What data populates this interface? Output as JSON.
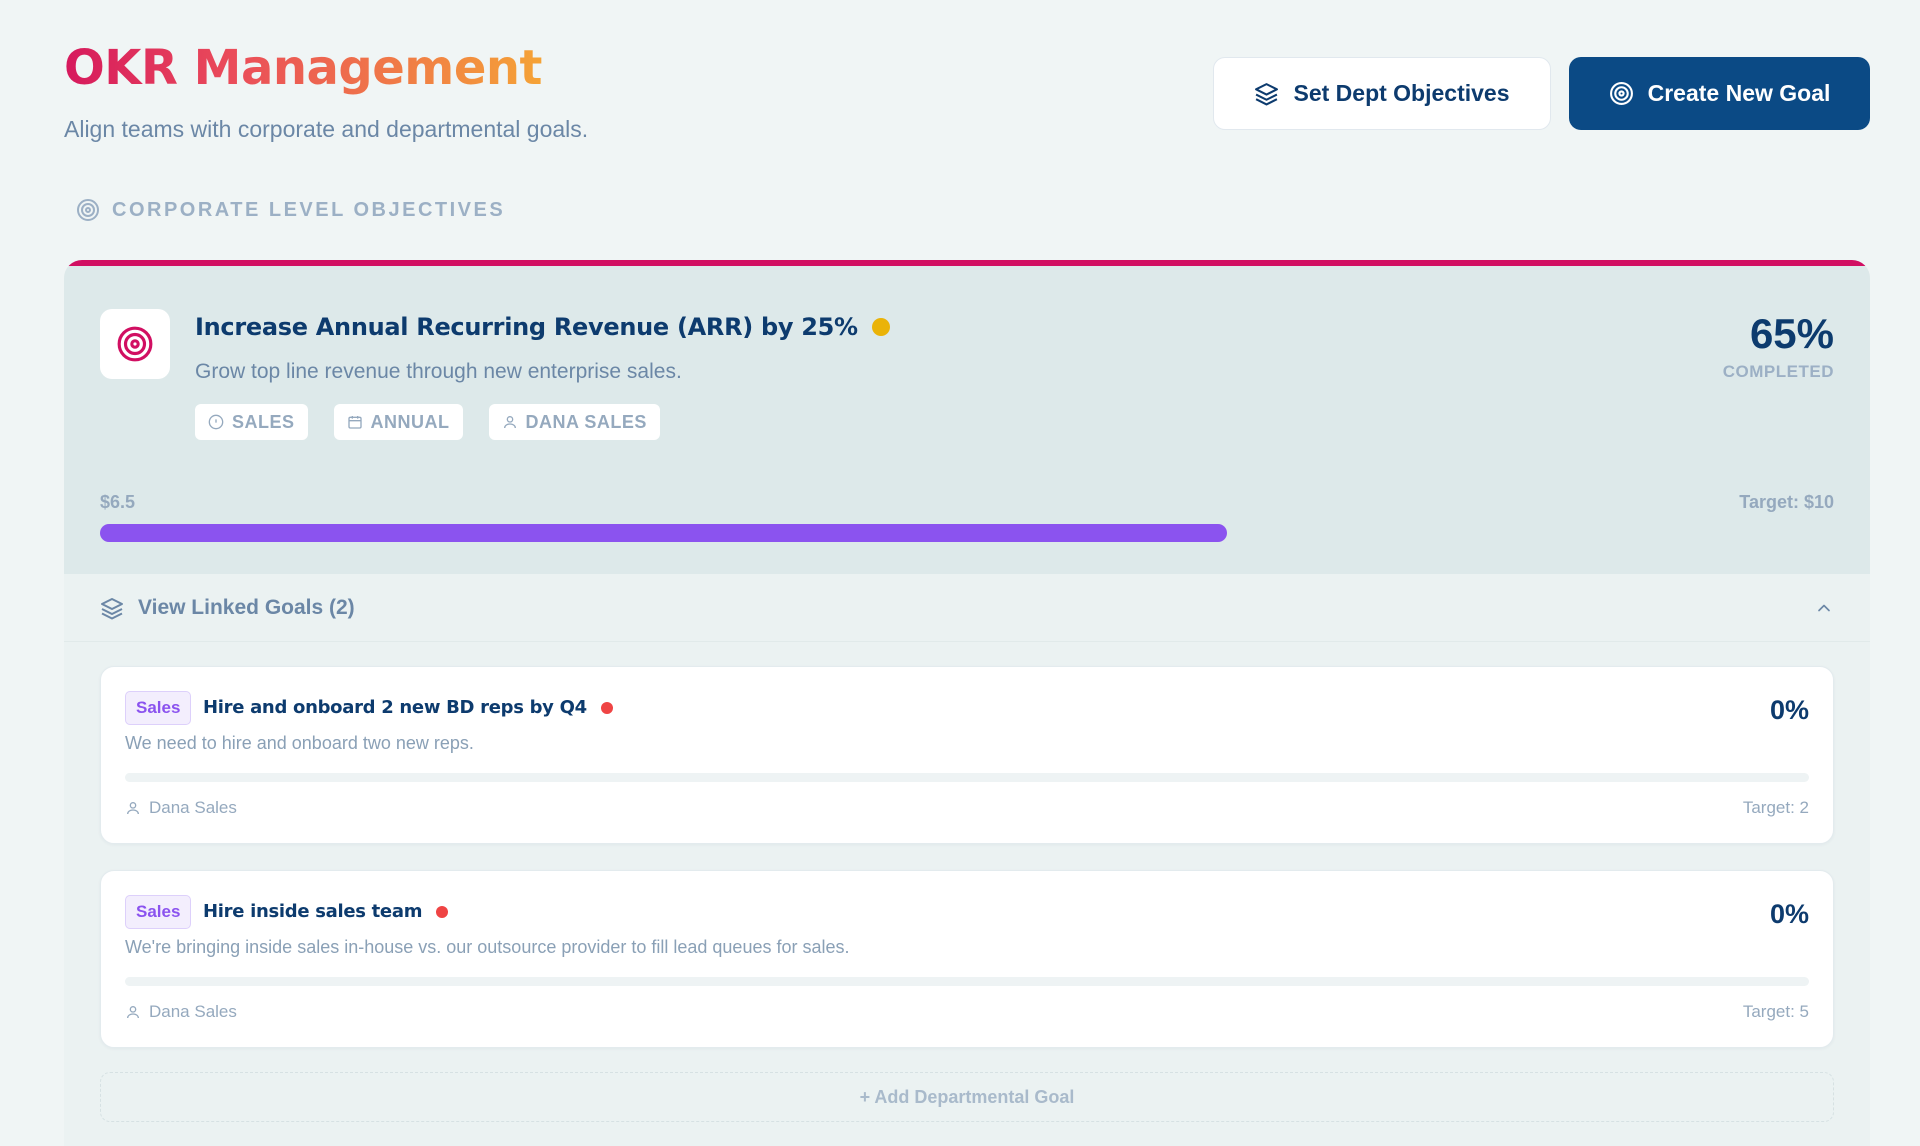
{
  "header": {
    "title": "OKR Management",
    "subtitle": "Align teams with corporate and departmental goals.",
    "set_dept_label": "Set Dept Objectives",
    "create_goal_label": "Create New Goal"
  },
  "section": {
    "label": "CORPORATE LEVEL OBJECTIVES"
  },
  "corporate_goal": {
    "title": "Increase Annual Recurring Revenue (ARR) by 25%",
    "status_color": "#eab308",
    "description": "Grow top line revenue through new enterprise sales.",
    "tags": {
      "department": "SALES",
      "period": "ANNUAL",
      "owner": "DANA SALES"
    },
    "percent": "65%",
    "percent_label": "COMPLETED",
    "progress": 0.65,
    "current_value": "$6.5",
    "target": "Target: $10",
    "progress_color": "#8b53ef",
    "accent_color": "#d10f62"
  },
  "linked": {
    "label": "View Linked Goals (2)",
    "goals": [
      {
        "dept": "Sales",
        "title": "Hire and onboard 2 new BD reps by Q4",
        "status_color": "#ef4444",
        "description": "We need to hire and onboard two new reps.",
        "percent": "0%",
        "progress": 0,
        "owner": "Dana Sales",
        "target": "Target: 2"
      },
      {
        "dept": "Sales",
        "title": "Hire inside sales team",
        "status_color": "#ef4444",
        "description": "We're bringing inside sales in-house vs. our outsource provider to fill lead queues for sales.",
        "percent": "0%",
        "progress": 0,
        "owner": "Dana Sales",
        "target": "Target: 5"
      }
    ],
    "add_label": "+ Add Departmental Goal"
  }
}
